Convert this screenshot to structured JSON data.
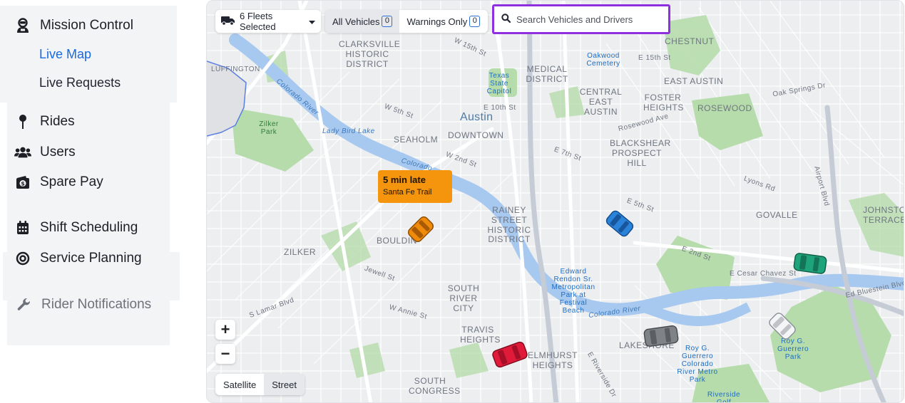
{
  "sidebar": {
    "mission_control": "Mission Control",
    "live_map": "Live Map",
    "live_requests": "Live Requests",
    "rides": "Rides",
    "users": "Users",
    "spare_pay": "Spare Pay",
    "shift_scheduling": "Shift Scheduling",
    "service_planning": "Service Planning",
    "rider_notifications": "Rider Notifications"
  },
  "map": {
    "fleet_select": "6 Fleets Selected",
    "filter_all": "All Vehicles",
    "filter_all_count": "0",
    "filter_warnings": "Warnings Only",
    "filter_warnings_count": "0",
    "search_placeholder": "Search Vehicles and Drivers",
    "zoom_in": "+",
    "zoom_out": "−",
    "layer_satellite": "Satellite",
    "layer_street": "Street",
    "alert": {
      "title": "5 min late",
      "stop": "Santa Fe Trail"
    },
    "labels": {
      "austin": "Austin",
      "downtown": "DOWNTOWN",
      "clarksville": "CLARKSVILLE HISTORIC DISTRICT",
      "medical": "MEDICAL DISTRICT",
      "central_east": "CENTRAL EAST AUSTIN",
      "east_austin": "EAST AUSTIN",
      "foster": "FOSTER HEIGHTS",
      "blackshear": "BLACKSHEAR PROSPECT HILL",
      "chestnut": "CHESTNUT",
      "rosewood": "ROSEWOOD",
      "seaholm": "SEAHOLM",
      "rainey": "RAINEY STREET HISTORIC DISTRICT",
      "bouldin": "BOULDIN",
      "zilker": "ZILKER",
      "south_river": "SOUTH RIVER CITY",
      "travis": "TRAVIS HEIGHTS",
      "elmhurst": "ELMHURST HEIGHTS",
      "lakeshore": "LAKESHORE",
      "govalle": "GOVALLE",
      "johnston": "JOHNSTON TERRACE",
      "south_congress": "SOUTH CONGRESS",
      "luffington": "LUFFINGTON",
      "lady_bird": "Lady Bird Lake",
      "colorado_river": "Colorado River",
      "colorado_river_2": "Colorado River",
      "colorado": "Colorado",
      "zilker_park": "Zilker Park",
      "oakwood": "Oakwood Cemetery",
      "capitol": "Texas State Capitol",
      "edward_rendon": "Edward Rendon Sr. Metropolitan Park at Festival Beach",
      "roy_guerrero": "Roy G. Guerrero Colorado River Metro Park",
      "roy_guerrero_2": "Roy G. Guerrero Park",
      "riverside": "Riverside Golf Course",
      "w15": "W 15th St",
      "e15": "E 15th St",
      "e10": "E 10th St",
      "w5": "W 5th St",
      "w2": "W 2nd St",
      "e7": "E 7th St",
      "e5": "E 5th St",
      "e2": "E 2nd St",
      "cesar": "E Cesar Chavez St",
      "rosewood_ave": "Rosewood Ave",
      "oak_springs": "Oak Springs Dr",
      "lyons": "Lyons Rd",
      "s_lamar": "S Lamar Blvd",
      "w_annie": "W Annie St",
      "jewell": "Jewell St",
      "ed_bluestein": "Ed Bluestein Blvd",
      "airport": "Airport Blvd",
      "riverside_dr": "E Riverside Dr"
    }
  },
  "colors": {
    "accent": "#1769e8",
    "alert": "#f5940d",
    "search_border": "#8e2fe0",
    "water": "#a7c8ef",
    "park": "#b6dcab"
  }
}
